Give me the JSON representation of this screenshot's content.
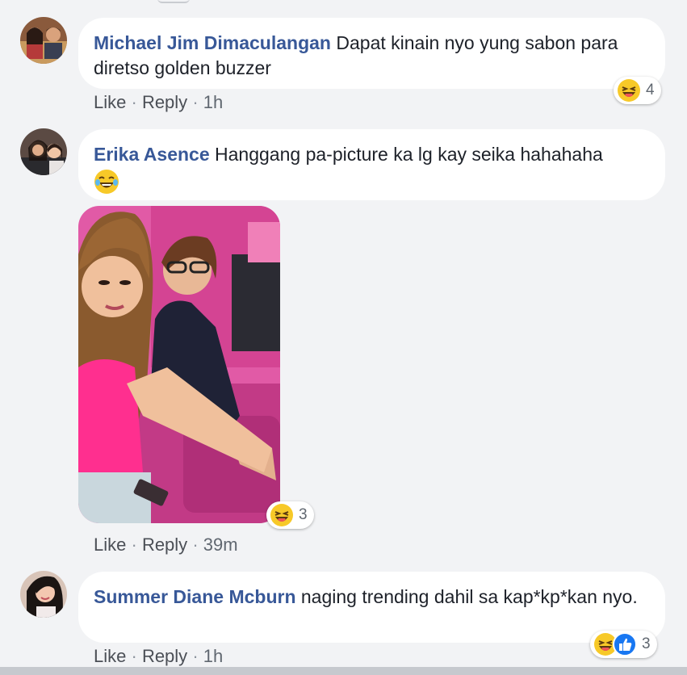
{
  "comments": [
    {
      "author": "Michael Jim Dimaculangan",
      "text": "Dapat kinain nyo yung sabon para diretso golden buzzer",
      "actions": {
        "like": "Like",
        "reply": "Reply",
        "time": "1h"
      },
      "reactions": {
        "icons": [
          "haha-icon"
        ],
        "count": "4"
      }
    },
    {
      "author": "Erika Asence",
      "text": "Hanggang pa-picture ka lg kay seika hahahaha",
      "emoji": "tears-of-joy-emoji",
      "attachment": "photo",
      "actions": {
        "like": "Like",
        "reply": "Reply",
        "time": "39m"
      },
      "reactions": {
        "icons": [
          "haha-icon"
        ],
        "count": "3"
      }
    },
    {
      "author": "Summer Diane Mcburn",
      "text": "naging trending dahil sa kap*kp*kan nyo.",
      "actions": {
        "like": "Like",
        "reply": "Reply",
        "time": "1h"
      },
      "reactions": {
        "icons": [
          "haha-icon",
          "like-icon"
        ],
        "count": "3"
      }
    }
  ],
  "separator": "·",
  "colors": {
    "background": "#f2f3f5",
    "author": "#385898",
    "text": "#1d2129",
    "action": "#4b4f56",
    "like_blue": "#1877f2",
    "haha_yellow": "#f7c928"
  }
}
